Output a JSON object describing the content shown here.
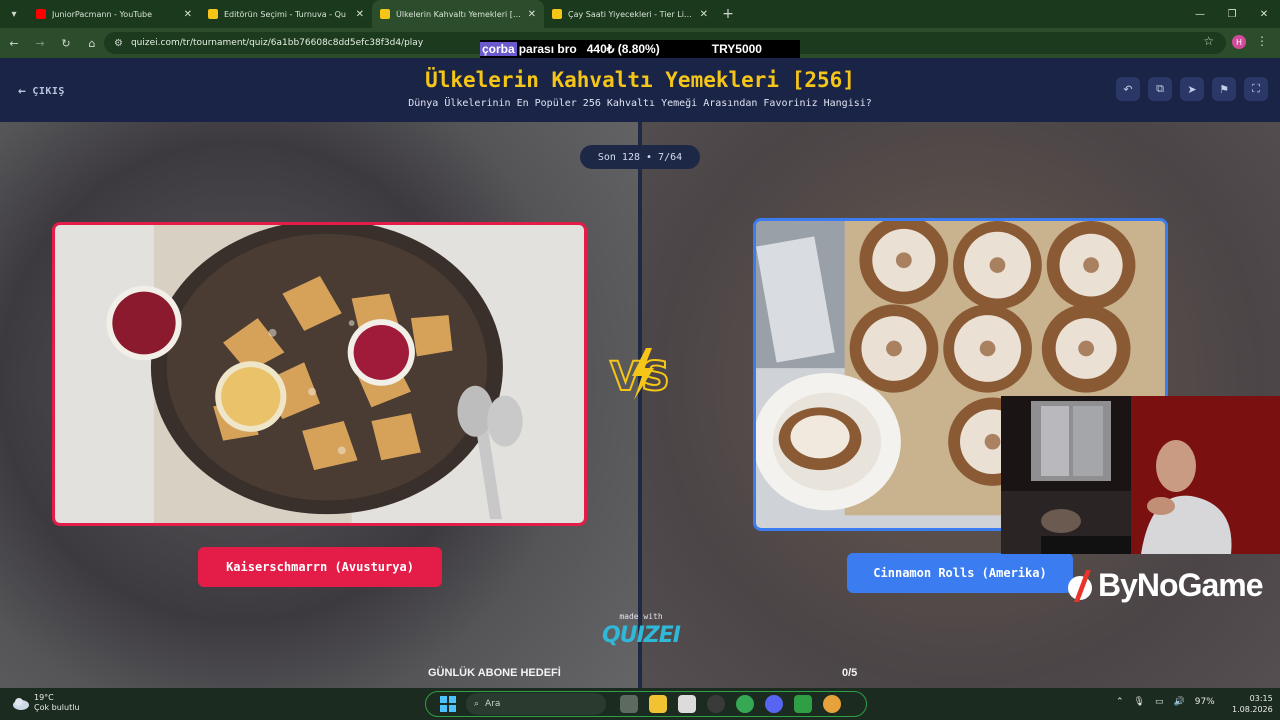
{
  "browser": {
    "tabs": [
      {
        "label": "JuniorPacmann - YouTube",
        "favicon_color": "#ff0000",
        "active": false
      },
      {
        "label": "Editörün Seçimi - Turnuva - Qu",
        "favicon_color": "#f5c518",
        "active": false
      },
      {
        "label": "Ülkelerin Kahvaltı Yemekleri [25",
        "favicon_color": "#f5c518",
        "active": true
      },
      {
        "label": "Çay Saati Yiyecekleri - Tier List,",
        "favicon_color": "#f5c518",
        "active": false
      }
    ],
    "url": "quizei.com/tr/tournament/quiz/6a1bb76608c8dd5efc38f3d4/play",
    "profile_initial": "H"
  },
  "overlay_ticker": {
    "highlight": "çorba",
    "text": "parası bro",
    "amount": "440₺ (8.80%)",
    "goal": "TRY5000"
  },
  "header": {
    "exit_label": "ÇIKIŞ",
    "title": "Ülkelerin Kahvaltı Yemekleri [256]",
    "subtitle": "Dünya Ülkelerinin En Popüler 256 Kahvaltı Yemeği Arasından Favoriniz Hangisi?"
  },
  "round": "Son 128 • 7/64",
  "left_choice": {
    "label": "Kaiserschmarrn (Avusturya)",
    "accent": "#e31d48"
  },
  "right_choice": {
    "label": "Cinnamon Rolls (Amerika)",
    "accent": "#3b7cf0"
  },
  "made_with": {
    "small": "made with",
    "brand": "QUIZEI"
  },
  "sub_goal": {
    "label": "GÜNLÜK ABONE HEDEFİ",
    "count": "0/5"
  },
  "sponsor": "ByNoGame",
  "taskbar": {
    "temp": "19°C",
    "weather": "Çok bulutlu",
    "search_placeholder": "Ara",
    "battery": "97%",
    "time": "03:15",
    "date": "1.08.2026"
  }
}
